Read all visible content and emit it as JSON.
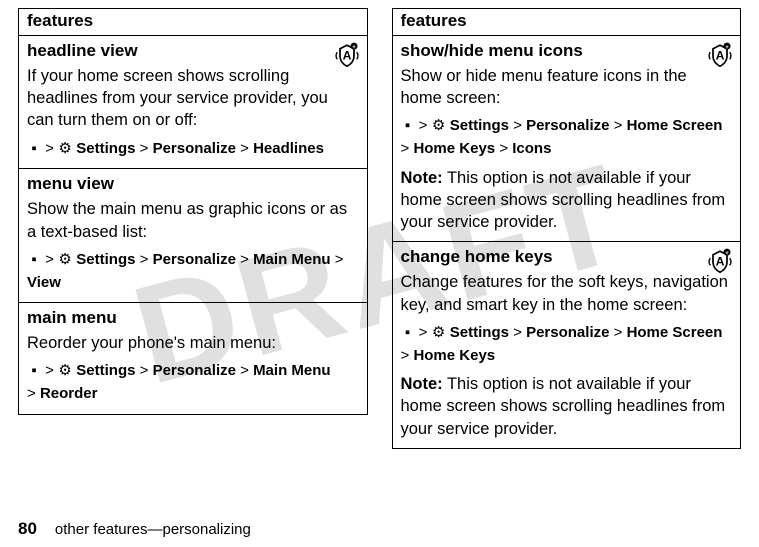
{
  "watermark": "DRAFT",
  "left": {
    "header": "features",
    "rows": [
      {
        "title": "headline view",
        "body": "If your home screen shows scrolling headlines from your service provider, you can turn them on or off:",
        "path_items": [
          "Settings",
          "Personalize",
          "Headlines"
        ],
        "has_icon": true
      },
      {
        "title": "menu view",
        "body": "Show the main menu as graphic icons or as a text-based list:",
        "path_items": [
          "Settings",
          "Personalize",
          "Main Menu",
          "View"
        ],
        "has_icon": false
      },
      {
        "title": "main menu",
        "body": "Reorder your phone's main menu:",
        "path_items": [
          "Settings",
          "Personalize",
          "Main Menu"
        ],
        "path_tail": "Reorder",
        "has_icon": false
      }
    ]
  },
  "right": {
    "header": "features",
    "rows": [
      {
        "title": "show/hide menu icons",
        "body": "Show or hide menu feature icons in the home screen:",
        "path_items": [
          "Settings",
          "Personalize",
          "Home Screen"
        ],
        "path_tail_items": [
          "Home Keys",
          "Icons"
        ],
        "note_label": "Note:",
        "note": " This option is not available if your home screen shows scrolling headlines from your service provider.",
        "has_icon": true
      },
      {
        "title": "change home keys",
        "body": "Change features for the soft keys, navigation key, and smart key in the home screen:",
        "path_items": [
          "Settings",
          "Personalize",
          "Home Screen"
        ],
        "path_tail_items": [
          "Home Keys"
        ],
        "note_label": "Note:",
        "note": " This option is not available if your home screen shows scrolling headlines from your service provider.",
        "has_icon": true
      }
    ]
  },
  "glyphs": {
    "center_key": "▪",
    "settings_icon": "⚙",
    "gt": ">"
  },
  "footer": {
    "page": "80",
    "text": "other features—personalizing"
  }
}
